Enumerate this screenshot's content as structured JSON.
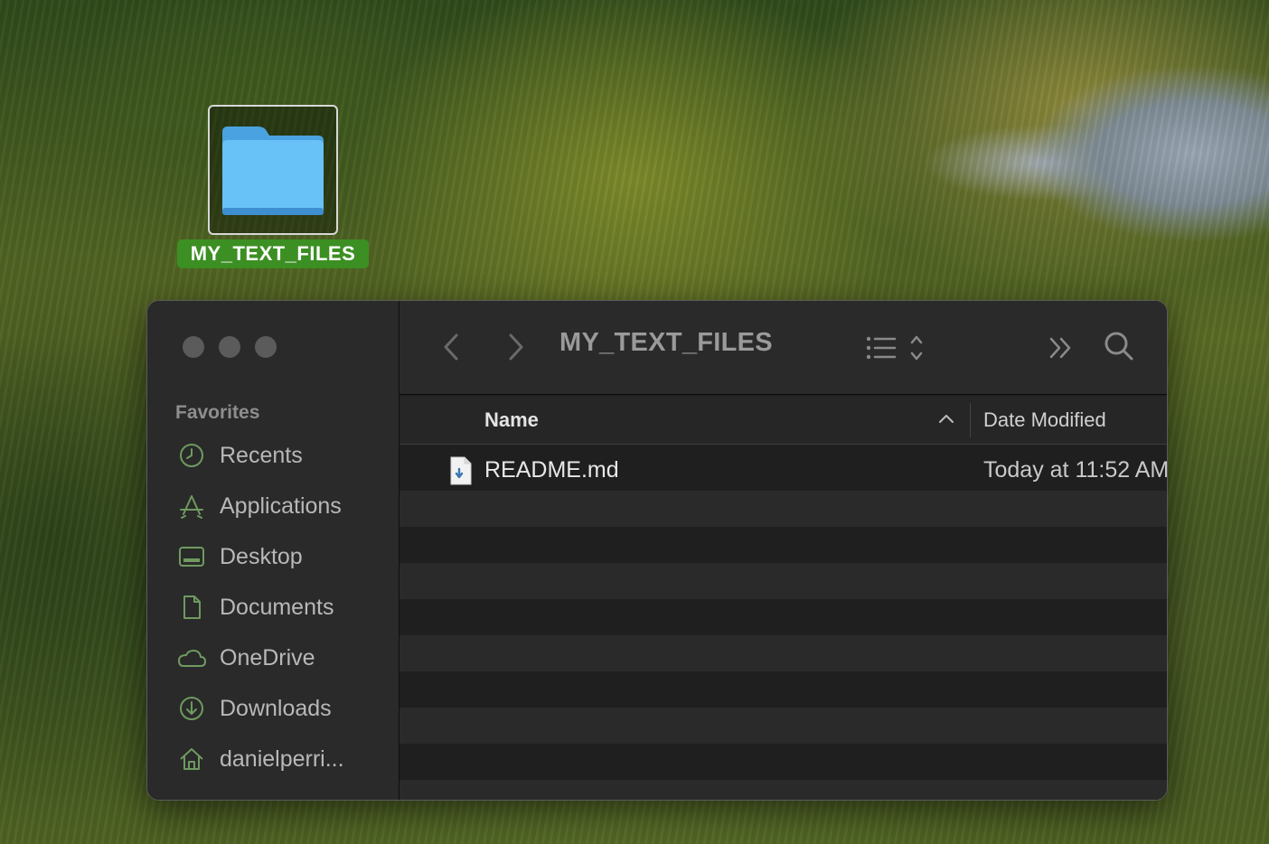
{
  "desktop": {
    "folder_label": "MY_TEXT_FILES"
  },
  "finder": {
    "title": "MY_TEXT_FILES",
    "sidebar": {
      "section": "Favorites",
      "items": [
        {
          "label": "Recents",
          "icon": "clock-icon"
        },
        {
          "label": "Applications",
          "icon": "applications-icon"
        },
        {
          "label": "Desktop",
          "icon": "desktop-icon"
        },
        {
          "label": "Documents",
          "icon": "document-icon"
        },
        {
          "label": "OneDrive",
          "icon": "cloud-icon"
        },
        {
          "label": "Downloads",
          "icon": "download-icon"
        },
        {
          "label": "danielperri...",
          "icon": "home-icon"
        }
      ]
    },
    "columns": {
      "name": "Name",
      "date_modified": "Date Modified"
    },
    "files": [
      {
        "name": "README.md",
        "date_modified": "Today at 11:52 AM"
      }
    ]
  },
  "colors": {
    "accent_selection": "#3c8f23",
    "folder_blue": "#5ab4f0",
    "sidebar_icon": "#6e9a5f"
  }
}
